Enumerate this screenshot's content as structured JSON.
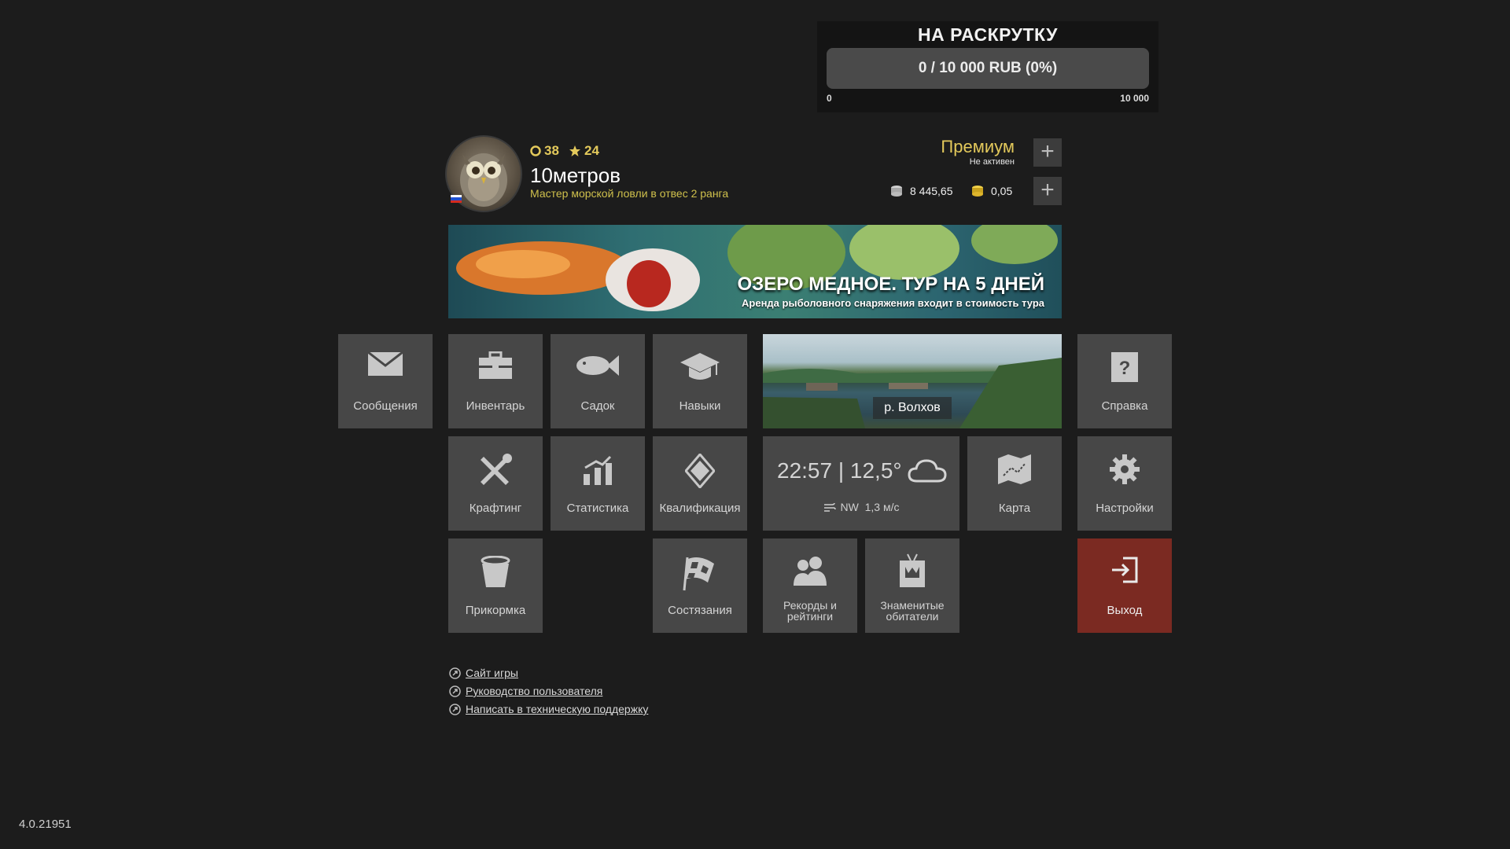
{
  "fundraiser": {
    "title": "НА РАСКРУТКУ",
    "progress_text": "0 / 10 000 RUB (0%)",
    "progress_fraction": 0,
    "min_label": "0",
    "max_label": "10 000"
  },
  "profile": {
    "level": "38",
    "stars": "24",
    "name": "10метров",
    "rank": "Мастер морской ловли в отвес 2 ранга",
    "premium_label": "Премиум",
    "premium_status": "Не активен",
    "silver": "8 445,65",
    "gold": "0,05",
    "accent": "#e3c95b"
  },
  "banner": {
    "title": "ОЗЕРО МЕДНОЕ. ТУР НА 5 ДНЕЙ",
    "subtitle": "Аренда рыболовного снаряжения входит в стоимость тура"
  },
  "tiles": {
    "messages": "Сообщения",
    "inventory": "Инвентарь",
    "keepnet": "Садок",
    "skills": "Навыки",
    "help": "Справка",
    "crafting": "Крафтинг",
    "statistics": "Статистика",
    "qualification": "Квалификация",
    "map": "Карта",
    "settings": "Настройки",
    "groundbait": "Прикормка",
    "competitions": "Состязания",
    "records_1": "Рекорды и",
    "records_2": "рейтинги",
    "trophy_1": "Знаменитые",
    "trophy_2": "обитатели",
    "exit": "Выход"
  },
  "location": {
    "name": "р. Волхов"
  },
  "weather": {
    "time_temp": "22:57 | 12,5°",
    "wind_dir": "NW",
    "wind_speed": "1,3 м/с",
    "icon": "cloud-icon"
  },
  "links": [
    "Сайт игры",
    "Руководство пользователя",
    "Написать в техническую поддержку"
  ],
  "version": "4.0.21951",
  "colors": {
    "background": "#1c1c1c",
    "tile": "#474747",
    "exit": "#7b2a22"
  }
}
